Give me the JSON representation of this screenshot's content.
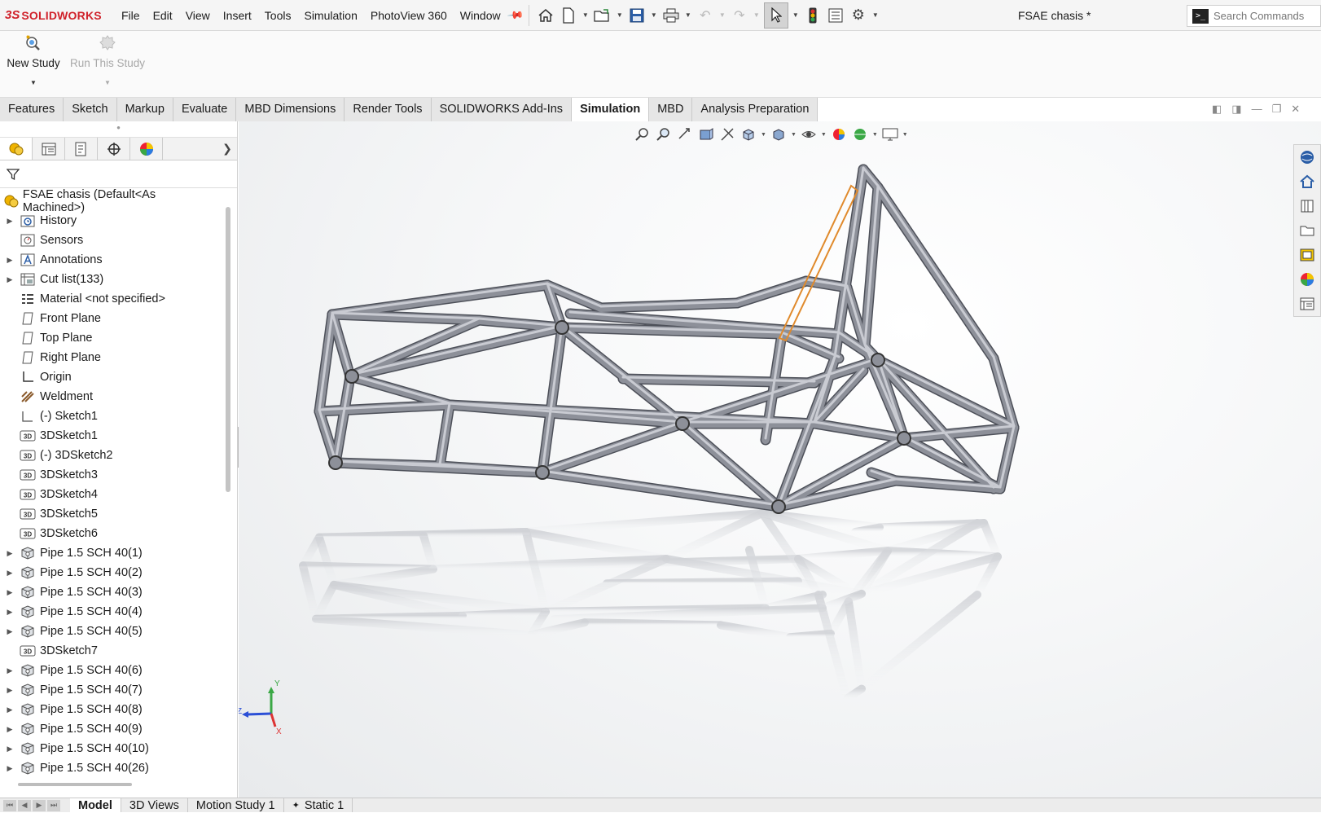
{
  "app": {
    "brand": "SOLIDWORKS",
    "brand_mark": "3S",
    "document_title": "FSAE chasis *"
  },
  "menu": [
    "File",
    "Edit",
    "View",
    "Insert",
    "Tools",
    "Simulation",
    "PhotoView 360",
    "Window"
  ],
  "search": {
    "placeholder": "Search Commands",
    "icon_label": ">_"
  },
  "command_manager": {
    "new_study": "New Study",
    "run_study": "Run This Study"
  },
  "tabs": [
    {
      "label": "Features",
      "active": false
    },
    {
      "label": "Sketch",
      "active": false
    },
    {
      "label": "Markup",
      "active": false
    },
    {
      "label": "Evaluate",
      "active": false
    },
    {
      "label": "MBD Dimensions",
      "active": false
    },
    {
      "label": "Render Tools",
      "active": false
    },
    {
      "label": "SOLIDWORKS Add-Ins",
      "active": false
    },
    {
      "label": "Simulation",
      "active": true
    },
    {
      "label": "MBD",
      "active": false
    },
    {
      "label": "Analysis Preparation",
      "active": false
    }
  ],
  "tree": {
    "root": "FSAE chasis (Default<As Machined>)",
    "items": [
      {
        "label": "History",
        "icon": "history-icon",
        "expandable": true
      },
      {
        "label": "Sensors",
        "icon": "sensors-icon",
        "expandable": false
      },
      {
        "label": "Annotations",
        "icon": "annotations-icon",
        "expandable": true
      },
      {
        "label": "Cut list(133)",
        "icon": "cut-list-icon",
        "expandable": true
      },
      {
        "label": "Material <not specified>",
        "icon": "material-icon",
        "expandable": false
      },
      {
        "label": "Front Plane",
        "icon": "plane-icon",
        "expandable": false
      },
      {
        "label": "Top Plane",
        "icon": "plane-icon",
        "expandable": false
      },
      {
        "label": "Right Plane",
        "icon": "plane-icon",
        "expandable": false
      },
      {
        "label": "Origin",
        "icon": "origin-icon",
        "expandable": false
      },
      {
        "label": "Weldment",
        "icon": "weldment-icon",
        "expandable": false
      },
      {
        "label": "(-) Sketch1",
        "icon": "sketch-icon",
        "expandable": false
      },
      {
        "label": "3DSketch1",
        "icon": "3dsketch-icon",
        "expandable": false
      },
      {
        "label": "(-) 3DSketch2",
        "icon": "3dsketch-icon",
        "expandable": false
      },
      {
        "label": "3DSketch3",
        "icon": "3dsketch-icon",
        "expandable": false
      },
      {
        "label": "3DSketch4",
        "icon": "3dsketch-icon",
        "expandable": false
      },
      {
        "label": "3DSketch5",
        "icon": "3dsketch-icon",
        "expandable": false
      },
      {
        "label": "3DSketch6",
        "icon": "3dsketch-icon",
        "expandable": false
      },
      {
        "label": "Pipe 1.5 SCH 40(1)",
        "icon": "structural-member-icon",
        "expandable": true
      },
      {
        "label": "Pipe 1.5 SCH 40(2)",
        "icon": "structural-member-icon",
        "expandable": true
      },
      {
        "label": "Pipe 1.5 SCH 40(3)",
        "icon": "structural-member-icon",
        "expandable": true
      },
      {
        "label": "Pipe 1.5 SCH 40(4)",
        "icon": "structural-member-icon",
        "expandable": true
      },
      {
        "label": "Pipe 1.5 SCH 40(5)",
        "icon": "structural-member-icon",
        "expandable": true
      },
      {
        "label": "3DSketch7",
        "icon": "3dsketch-icon",
        "expandable": false
      },
      {
        "label": "Pipe 1.5 SCH 40(6)",
        "icon": "structural-member-icon",
        "expandable": true
      },
      {
        "label": "Pipe 1.5 SCH 40(7)",
        "icon": "structural-member-icon",
        "expandable": true
      },
      {
        "label": "Pipe 1.5 SCH 40(8)",
        "icon": "structural-member-icon",
        "expandable": true
      },
      {
        "label": "Pipe 1.5 SCH 40(9)",
        "icon": "structural-member-icon",
        "expandable": true
      },
      {
        "label": "Pipe 1.5 SCH 40(10)",
        "icon": "structural-member-icon",
        "expandable": true
      },
      {
        "label": "Pipe 1.5 SCH 40(26)",
        "icon": "structural-member-icon",
        "expandable": true
      }
    ]
  },
  "triad": {
    "y": "Y",
    "z": "Z",
    "x": "X"
  },
  "bottom_tabs": [
    {
      "label": "Model",
      "active": true
    },
    {
      "label": "3D Views",
      "active": false
    },
    {
      "label": "Motion Study 1",
      "active": false
    },
    {
      "label": "Static 1",
      "active": false
    }
  ],
  "colors": {
    "brand_red": "#d0212a",
    "selection_orange": "#e08a2c",
    "tube_gray": "#7c7f88"
  }
}
